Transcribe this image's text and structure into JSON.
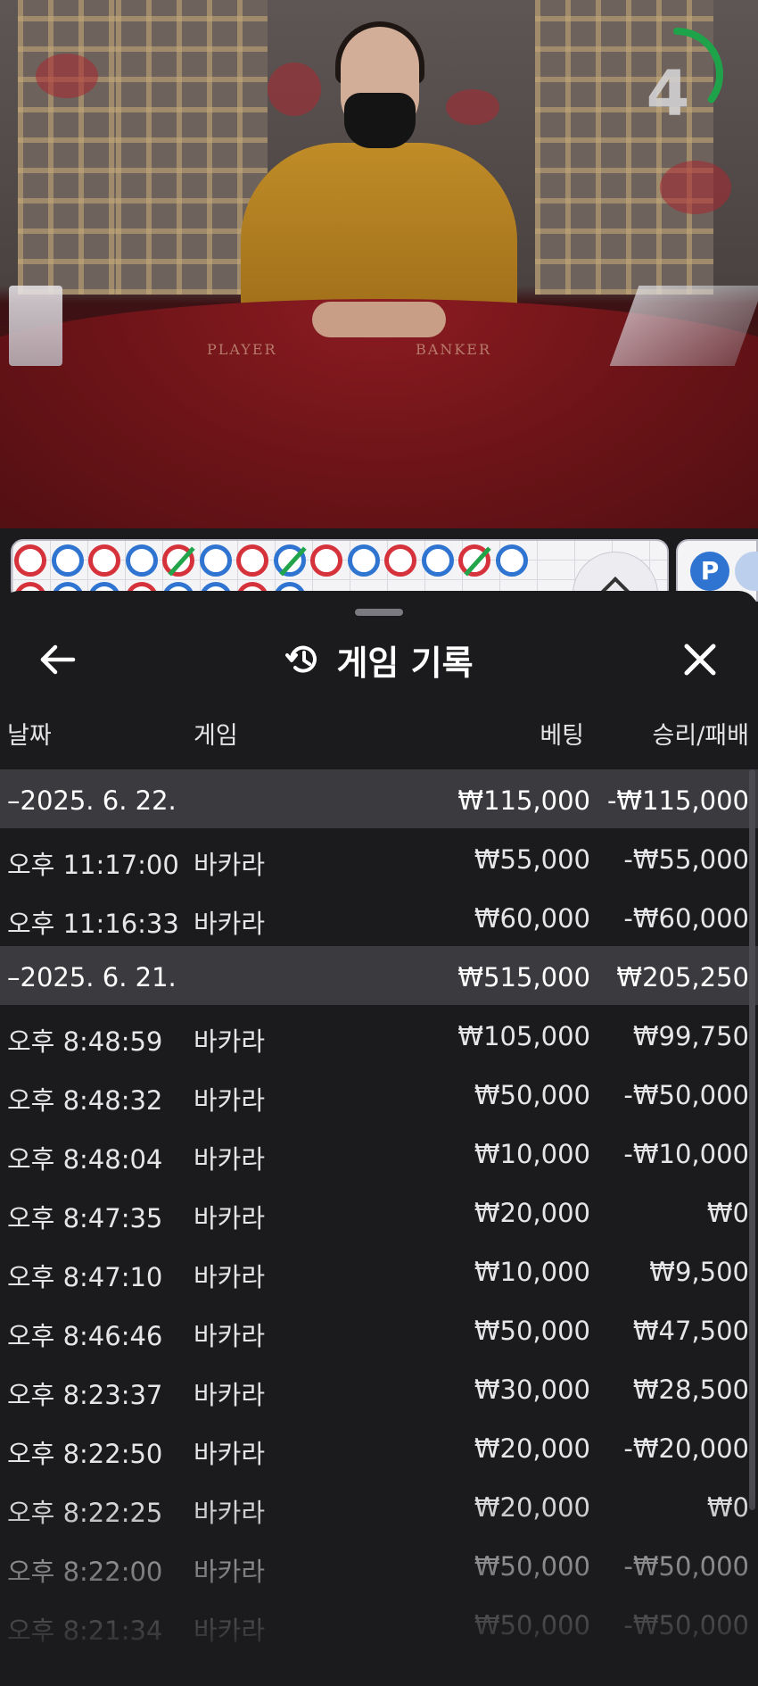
{
  "video": {
    "table_labels": {
      "player": "PLAYER",
      "banker": "BANKER"
    },
    "timer": {
      "value": "4",
      "fraction": 0.35,
      "color": "#1fa34a"
    }
  },
  "roadmap": {
    "beads_top": [
      "B",
      "P",
      "B",
      "P",
      "B/",
      "P",
      "B",
      "P/",
      "B",
      "P",
      "B",
      "P",
      "B/",
      "P"
    ],
    "p_button": "P",
    "colors": {
      "banker": "#d6323c",
      "player": "#2f74d0",
      "tie": "#22a54a"
    }
  },
  "sheet": {
    "title": "게임 기록",
    "icons": {
      "back": "arrow-left-icon",
      "history": "history-icon",
      "close": "close-icon"
    },
    "columns": {
      "date": "날짜",
      "game": "게임",
      "bet": "베팅",
      "result": "승리/패배"
    },
    "groups": [
      {
        "date": "–2025. 6. 22.",
        "bet_total": "₩115,000",
        "result_total": "-₩115,000",
        "rows": [
          {
            "time": "오후 11:17:00",
            "game": "바카라",
            "bet": "₩55,000",
            "result": "-₩55,000"
          },
          {
            "time": "오후 11:16:33",
            "game": "바카라",
            "bet": "₩60,000",
            "result": "-₩60,000"
          }
        ]
      },
      {
        "date": "–2025. 6. 21.",
        "bet_total": "₩515,000",
        "result_total": "₩205,250",
        "rows": [
          {
            "time": "오후 8:48:59",
            "game": "바카라",
            "bet": "₩105,000",
            "result": "₩99,750"
          },
          {
            "time": "오후 8:48:32",
            "game": "바카라",
            "bet": "₩50,000",
            "result": "-₩50,000"
          },
          {
            "time": "오후 8:48:04",
            "game": "바카라",
            "bet": "₩10,000",
            "result": "-₩10,000"
          },
          {
            "time": "오후 8:47:35",
            "game": "바카라",
            "bet": "₩20,000",
            "result": "₩0"
          },
          {
            "time": "오후 8:47:10",
            "game": "바카라",
            "bet": "₩10,000",
            "result": "₩9,500"
          },
          {
            "time": "오후 8:46:46",
            "game": "바카라",
            "bet": "₩50,000",
            "result": "₩47,500"
          },
          {
            "time": "오후 8:23:37",
            "game": "바카라",
            "bet": "₩30,000",
            "result": "₩28,500"
          },
          {
            "time": "오후 8:22:50",
            "game": "바카라",
            "bet": "₩20,000",
            "result": "-₩20,000"
          },
          {
            "time": "오후 8:22:25",
            "game": "바카라",
            "bet": "₩20,000",
            "result": "₩0"
          },
          {
            "time": "오후 8:22:00",
            "game": "바카라",
            "bet": "₩50,000",
            "result": "-₩50,000"
          },
          {
            "time": "오후 8:21:34",
            "game": "바카라",
            "bet": "₩50,000",
            "result": "-₩50,000"
          }
        ]
      }
    ]
  }
}
